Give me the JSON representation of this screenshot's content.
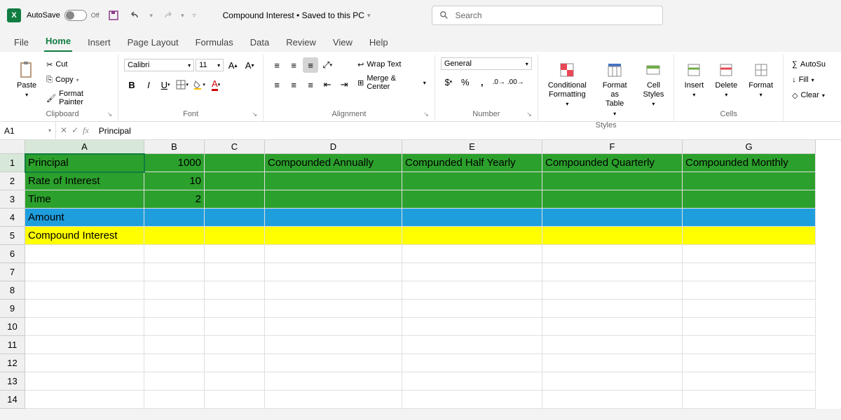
{
  "titlebar": {
    "autosave_label": "AutoSave",
    "autosave_state": "Off",
    "doc_title": "Compound Interest • Saved to this PC",
    "search_placeholder": "Search"
  },
  "tabs": [
    "File",
    "Home",
    "Insert",
    "Page Layout",
    "Formulas",
    "Data",
    "Review",
    "View",
    "Help"
  ],
  "active_tab": "Home",
  "ribbon": {
    "clipboard": {
      "paste": "Paste",
      "cut": "Cut",
      "copy": "Copy",
      "painter": "Format Painter",
      "label": "Clipboard"
    },
    "font": {
      "name": "Calibri",
      "size": "11",
      "label": "Font"
    },
    "alignment": {
      "wrap": "Wrap Text",
      "merge": "Merge & Center",
      "label": "Alignment"
    },
    "number": {
      "format": "General",
      "label": "Number"
    },
    "styles": {
      "conditional": "Conditional\nFormatting",
      "table": "Format as\nTable",
      "cell": "Cell\nStyles",
      "label": "Styles"
    },
    "cells": {
      "insert": "Insert",
      "delete": "Delete",
      "format": "Format",
      "label": "Cells"
    },
    "editing": {
      "autosum": "AutoSu",
      "fill": "Fill",
      "clear": "Clear"
    }
  },
  "formula_bar": {
    "name_box": "A1",
    "formula": "Principal"
  },
  "columns": [
    "A",
    "B",
    "C",
    "D",
    "E",
    "F",
    "G"
  ],
  "rows": [
    {
      "n": 1,
      "fill": "green",
      "sel": true,
      "cells": {
        "A": "Principal",
        "B": "1000",
        "D": "Compounded Annually",
        "E": "Compunded Half Yearly",
        "F": "Compounded Quarterly",
        "G": "Compounded Monthly"
      }
    },
    {
      "n": 2,
      "fill": "green",
      "cells": {
        "A": "Rate of Interest",
        "B": "10"
      }
    },
    {
      "n": 3,
      "fill": "green",
      "cells": {
        "A": "Time",
        "B": "2"
      }
    },
    {
      "n": 4,
      "fill": "blue",
      "cells": {
        "A": "Amount"
      }
    },
    {
      "n": 5,
      "fill": "yellow",
      "cells": {
        "A": "Compound Interest"
      }
    },
    {
      "n": 6
    },
    {
      "n": 7
    },
    {
      "n": 8
    },
    {
      "n": 9
    },
    {
      "n": 10
    },
    {
      "n": 11
    },
    {
      "n": 12
    },
    {
      "n": 13
    },
    {
      "n": 14
    }
  ]
}
